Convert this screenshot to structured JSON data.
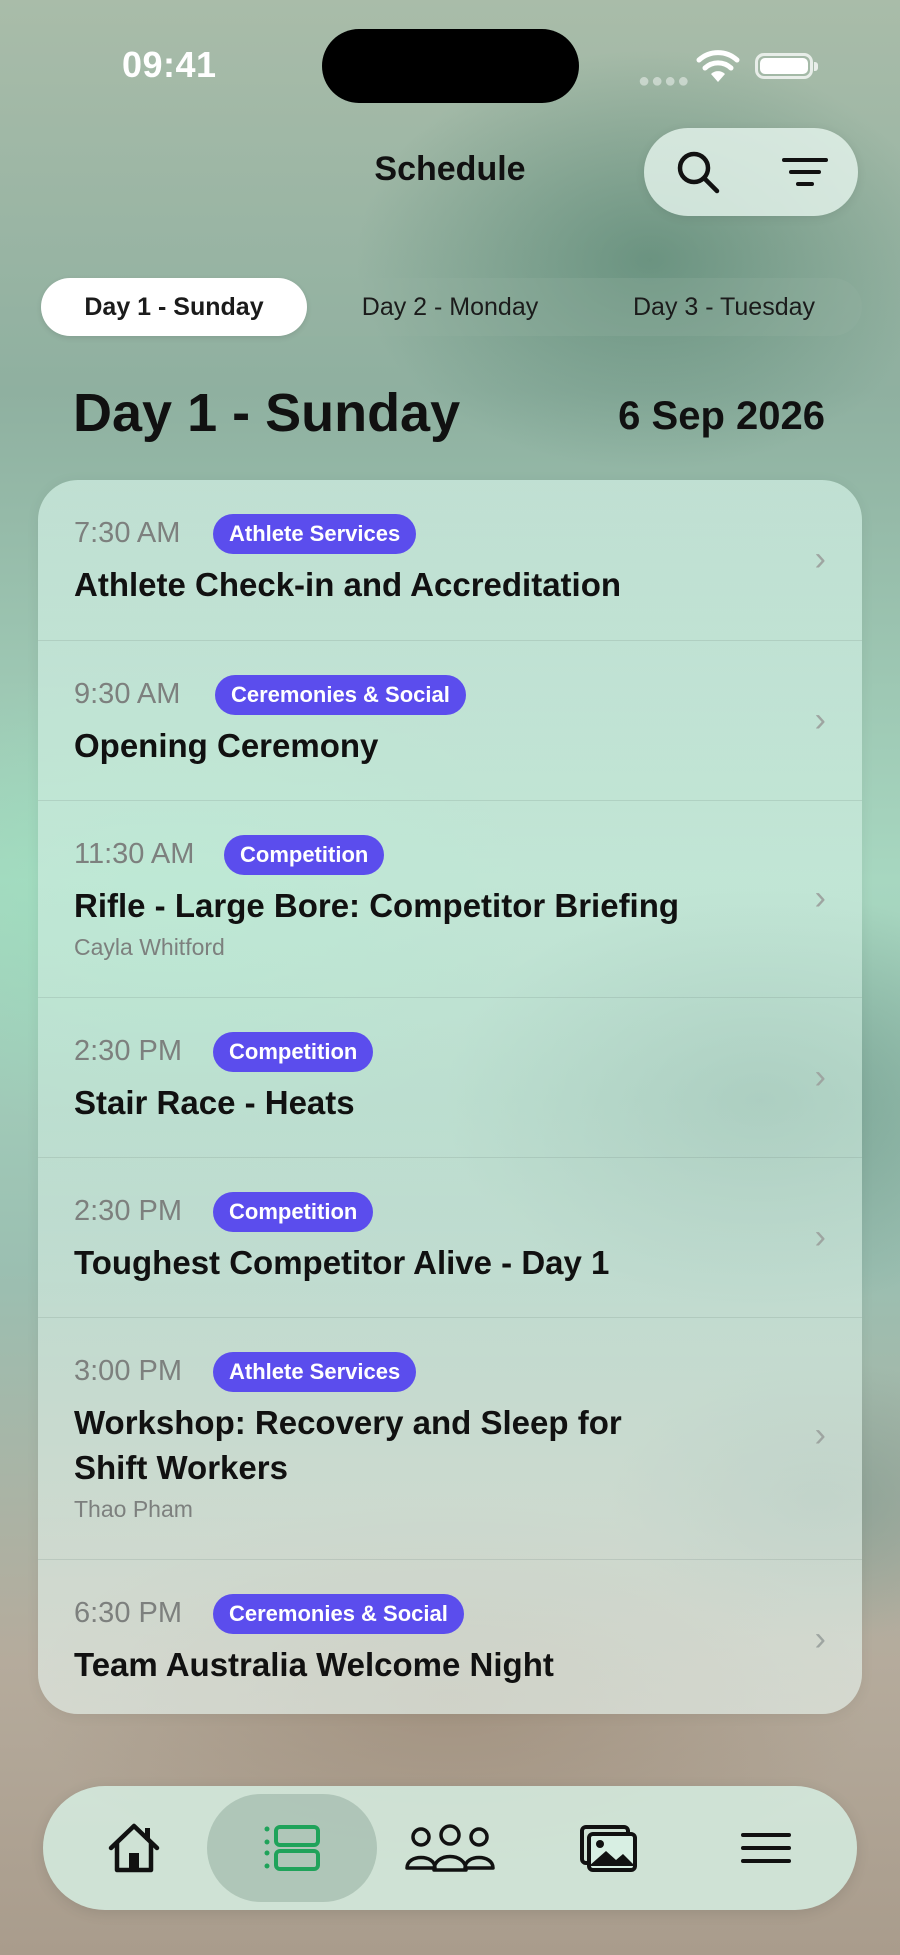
{
  "status": {
    "time": "09:41"
  },
  "header": {
    "title": "Schedule",
    "search_icon": "search-icon",
    "filter_icon": "filter-icon"
  },
  "day_tabs": [
    {
      "label": "Day 1 - Sunday",
      "selected": true
    },
    {
      "label": "Day 2 - Monday",
      "selected": false
    },
    {
      "label": "Day 3 - Tuesday",
      "selected": false
    }
  ],
  "day": {
    "title": "Day 1 - Sunday",
    "date": "6 Sep 2026"
  },
  "events": [
    {
      "time": "7:30 AM",
      "category": "Athlete Services",
      "title": "Athlete Check-in and Accreditation",
      "subtitle": ""
    },
    {
      "time": "9:30 AM",
      "category": "Ceremonies & Social",
      "title": "Opening Ceremony",
      "subtitle": ""
    },
    {
      "time": "11:30 AM",
      "category": "Competition",
      "title": "Rifle - Large Bore: Competitor Briefing",
      "subtitle": "Cayla Whitford"
    },
    {
      "time": "2:30 PM",
      "category": "Competition",
      "title": "Stair Race - Heats",
      "subtitle": ""
    },
    {
      "time": "2:30 PM",
      "category": "Competition",
      "title": "Toughest Competitor Alive - Day 1",
      "subtitle": ""
    },
    {
      "time": "3:00 PM",
      "category": "Athlete Services",
      "title": "Workshop: Recovery and Sleep for Shift Workers",
      "subtitle": "Thao Pham"
    },
    {
      "time": "6:30 PM",
      "category": "Ceremonies & Social",
      "title": "Team Australia Welcome Night",
      "subtitle": ""
    }
  ],
  "tab_bar": [
    {
      "icon": "home-icon",
      "active": false
    },
    {
      "icon": "schedule-icon",
      "active": true
    },
    {
      "icon": "people-icon",
      "active": false
    },
    {
      "icon": "gallery-icon",
      "active": false
    },
    {
      "icon": "menu-icon",
      "active": false
    }
  ],
  "colors": {
    "badge": "#5b4ded",
    "active_icon": "#1fa35a"
  }
}
